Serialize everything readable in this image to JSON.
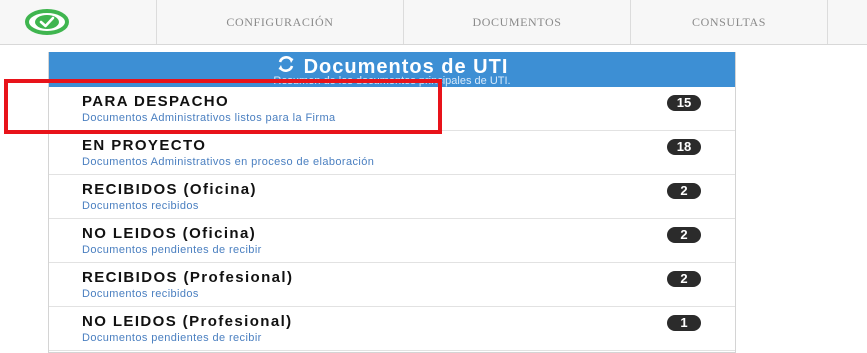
{
  "navbar": {
    "logo_icon": "check-circle-icon",
    "brand_color": "#3fb54f",
    "items": [
      {
        "label": "CONFIGURACIÓN"
      },
      {
        "label": "DOCUMENTOS"
      },
      {
        "label": "CONSULTAS"
      }
    ]
  },
  "panel": {
    "refresh_icon": "refresh-icon",
    "title": "Documentos de UTI",
    "subtitle": "Resumen de los documentos principales de UTI.",
    "header_color": "#3d8fd4",
    "items": [
      {
        "title": "PARA DESPACHO",
        "description": "Documentos Administrativos listos para la Firma",
        "count": "15"
      },
      {
        "title": "EN PROYECTO",
        "description": "Documentos Administrativos en proceso de elaboración",
        "count": "18"
      },
      {
        "title": "RECIBIDOS (Oficina)",
        "description": "Documentos recibidos",
        "count": "2"
      },
      {
        "title": "NO LEIDOS (Oficina)",
        "description": "Documentos pendientes de recibir",
        "count": "2"
      },
      {
        "title": "RECIBIDOS (Profesional)",
        "description": "Documentos recibidos",
        "count": "2"
      },
      {
        "title": "NO LEIDOS (Profesional)",
        "description": "Documentos pendientes de recibir",
        "count": "1"
      }
    ]
  },
  "highlight_color": "#e8131a"
}
